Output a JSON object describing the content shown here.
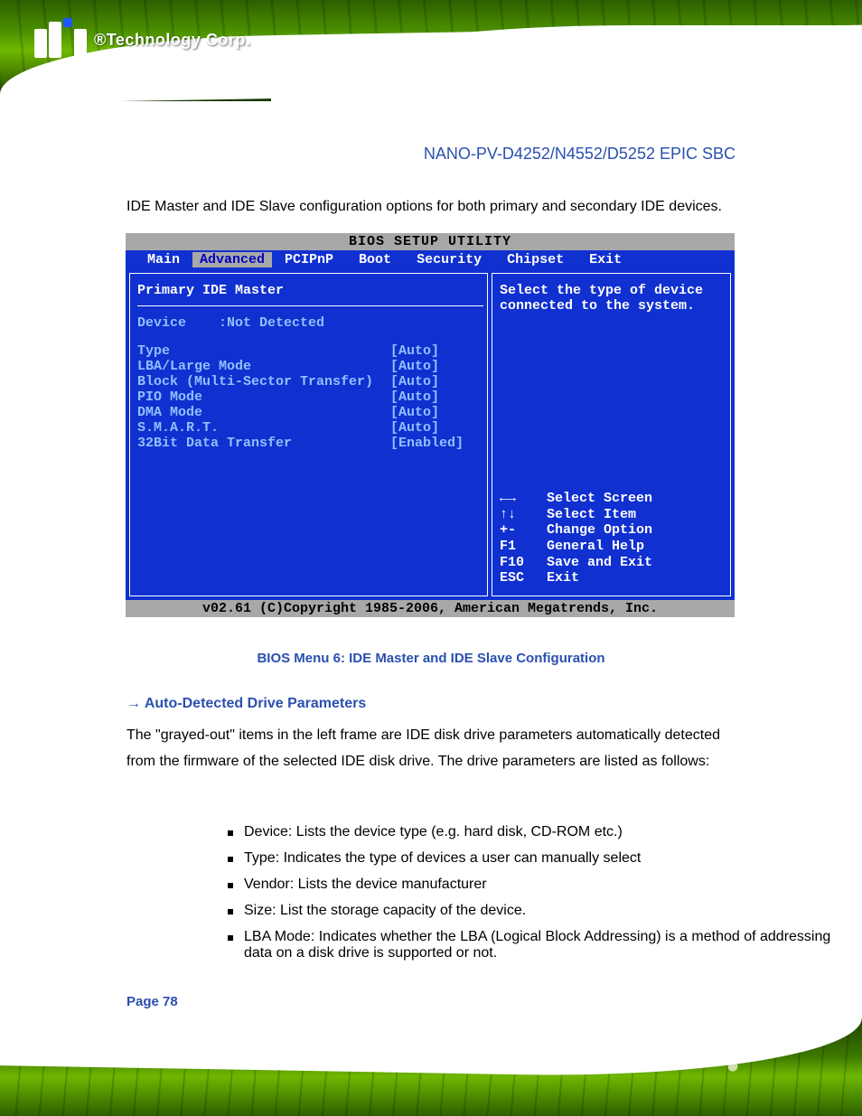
{
  "header": {
    "logo_text": "®Technology Corp.",
    "doc_title": "NANO-PV-D4252/N4552/D5252 EPIC SBC"
  },
  "intro": "IDE Master and IDE Slave configuration options for both primary and secondary IDE devices.",
  "bios": {
    "title": "BIOS SETUP UTILITY",
    "tabs": [
      "Main",
      "Advanced",
      "PCIPnP",
      "Boot",
      "Security",
      "Chipset",
      "Exit"
    ],
    "selected_tab": "Advanced",
    "section_title": "Primary IDE Master",
    "device_label": "Device",
    "device_value": ":Not Detected",
    "rows": [
      {
        "label": "Type",
        "value": "[Auto]"
      },
      {
        "label": "LBA/Large Mode",
        "value": "[Auto]"
      },
      {
        "label": "Block (Multi-Sector Transfer)",
        "value": "[Auto]"
      },
      {
        "label": "PIO Mode",
        "value": "[Auto]"
      },
      {
        "label": "DMA Mode",
        "value": "[Auto]"
      },
      {
        "label": "S.M.A.R.T.",
        "value": "[Auto]"
      },
      {
        "label": "32Bit Data Transfer",
        "value": "[Enabled]"
      }
    ],
    "help_text": "Select the type of device connected to the system.",
    "keys": [
      {
        "k": "←→",
        "d": "Select Screen"
      },
      {
        "k": "↑↓",
        "d": "Select Item"
      },
      {
        "k": "+-",
        "d": "Change Option"
      },
      {
        "k": "F1",
        "d": "General Help"
      },
      {
        "k": "F10",
        "d": "Save and Exit"
      },
      {
        "k": "ESC",
        "d": "Exit"
      }
    ],
    "footer": "v02.61 (C)Copyright 1985-2006, American Megatrends, Inc."
  },
  "caption": "BIOS Menu 6: IDE Master and IDE Slave Configuration",
  "autodetect": {
    "heading": "→ Auto-Detected Drive Parameters",
    "para": "The \"grayed-out\" items in the left frame are IDE disk drive parameters automatically detected from the firmware of the selected IDE disk drive. The drive parameters are listed as follows:",
    "items": [
      "Device: Lists the device type (e.g. hard disk, CD-ROM etc.)",
      "Type: Indicates the type of devices a user can manually select",
      "Vendor: Lists the device manufacturer",
      "Size: List the storage capacity of the device.",
      "LBA Mode: Indicates whether the LBA (Logical Block Addressing) is a method of addressing data on a disk drive is supported or not."
    ]
  },
  "page_number": "Page 78"
}
